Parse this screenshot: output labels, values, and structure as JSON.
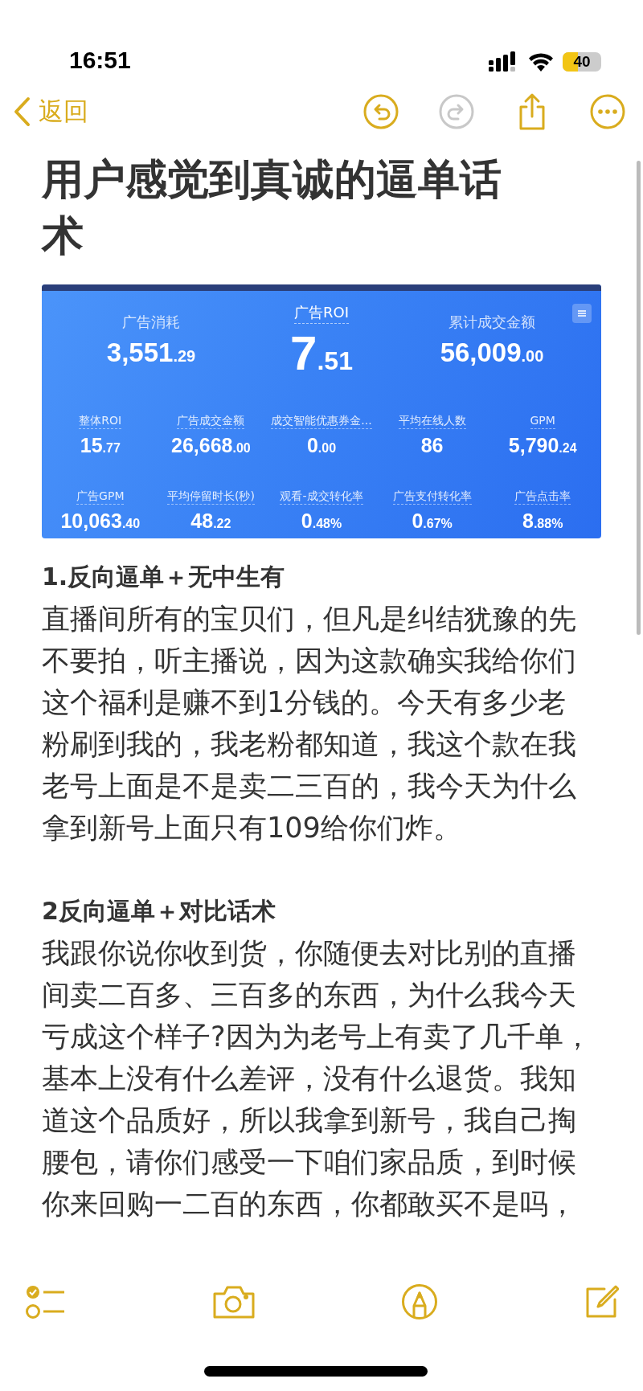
{
  "status_bar": {
    "time": "16:51",
    "battery": "40"
  },
  "nav": {
    "back": "返回",
    "actions": [
      {
        "kind": "undo",
        "disabled": false
      },
      {
        "kind": "redo",
        "disabled": true
      },
      {
        "kind": "share",
        "disabled": false
      },
      {
        "kind": "more",
        "disabled": false
      }
    ]
  },
  "note": {
    "title": "用户感觉到真诚的逼单话术",
    "dashboard": {
      "top": [
        {
          "label": "广告消耗",
          "value": "3,551",
          "fraction": ".29",
          "featured": false
        },
        {
          "label": "广告ROI",
          "value": "7",
          "fraction": ".51",
          "featured": true
        },
        {
          "label": "累计成交金额",
          "value": "56,009",
          "fraction": ".00",
          "featured": false
        }
      ],
      "rows": [
        [
          {
            "label": "整体ROI",
            "value": "15",
            "fraction": ".77"
          },
          {
            "label": "广告成交金额",
            "value": "26,668",
            "fraction": ".00"
          },
          {
            "label": "成交智能优惠券金...",
            "value": "0",
            "fraction": ".00"
          },
          {
            "label": "平均在线人数",
            "value": "86"
          },
          {
            "label": "GPM",
            "value": "5,790",
            "fraction": ".24"
          }
        ],
        [
          {
            "label": "广告GPM",
            "value": "10,063",
            "fraction": ".40"
          },
          {
            "label": "平均停留时长(秒)",
            "value": "48",
            "fraction": ".22"
          },
          {
            "label": "观看-成交转化率",
            "value": "0",
            "fraction": ".48%"
          },
          {
            "label": "广告支付转化率",
            "value": "0",
            "fraction": ".67%"
          },
          {
            "label": "广告点击率",
            "value": "8",
            "fraction": ".88%"
          }
        ]
      ]
    },
    "sections": [
      {
        "heading": "1.反向逼单＋无中生有",
        "body": "直播间所有的宝贝们，但凡是纠结犹豫的先不要拍，听主播说，因为这款确实我给你们这个福利是赚不到1分钱的。今天有多少老粉刷到我的，我老粉都知道，我这个款在我老号上面是不是卖二三百的，我今天为什么拿到新号上面只有109给你们炸。"
      },
      {
        "heading": "2反向逼单＋对比话术",
        "body": "我跟你说你收到货，你随便去对比别的直播间卖二百多、三百多的东西，为什么我今天亏成这个样子?因为为老号上有卖了几千单，基本上没有什么差评，没有什么退货。我知道这个品质好，所以我拿到新号，我自己掏腰包，请你们感受一下咱们家品质，到时候你来回购一二百的东西，你都敢买不是吗，"
      }
    ]
  },
  "toolbar": [
    {
      "kind": "checklist"
    },
    {
      "kind": "camera"
    },
    {
      "kind": "markup"
    },
    {
      "kind": "compose"
    }
  ]
}
